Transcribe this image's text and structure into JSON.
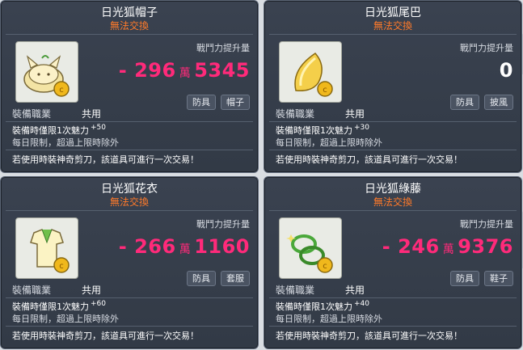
{
  "cards": [
    {
      "title": "日光狐帽子",
      "tradable": "無法交換",
      "power_label": "戰鬥力提升量",
      "power_prefix": "- 296",
      "power_unit": "萬",
      "power_rest": "5345",
      "tags": [
        "防具",
        "帽子"
      ],
      "job_label": "裝備職業",
      "job_value": "共用",
      "stat_text": "裝備時僅限1次魅力",
      "stat_bonus": "+50",
      "daily": "每日限制，超過上限時除外",
      "scissors": "若使用時裝神奇剪刀，該道具可進行一次交易！",
      "icon": "fox-hat-icon"
    },
    {
      "title": "日光狐尾巴",
      "tradable": "無法交換",
      "power_label": "戰鬥力提升量",
      "power_value": "0",
      "tags": [
        "防具",
        "披風"
      ],
      "job_label": "裝備職業",
      "job_value": "共用",
      "stat_text": "裝備時僅限1次魅力",
      "stat_bonus": "+30",
      "daily": "每日限制，超過上限時除外",
      "scissors": "若使用時裝神奇剪刀，該道具可進行一次交易！",
      "icon": "fox-tail-icon"
    },
    {
      "title": "日光狐花衣",
      "tradable": "無法交換",
      "power_label": "戰鬥力提升量",
      "power_prefix": "- 266",
      "power_unit": "萬",
      "power_rest": "1160",
      "tags": [
        "防具",
        "套服"
      ],
      "job_label": "裝備職業",
      "job_value": "共用",
      "stat_text": "裝備時僅限1次魅力",
      "stat_bonus": "+60",
      "daily": "每日限制，超過上限時除外",
      "scissors": "若使用時裝神奇剪刀，該道具可進行一次交易！",
      "icon": "fox-outfit-icon"
    },
    {
      "title": "日光狐綠藤",
      "tradable": "無法交換",
      "power_label": "戰鬥力提升量",
      "power_prefix": "- 246",
      "power_unit": "萬",
      "power_rest": "9376",
      "tags": [
        "防具",
        "鞋子"
      ],
      "job_label": "裝備職業",
      "job_value": "共用",
      "stat_text": "裝備時僅限1次魅力",
      "stat_bonus": "+40",
      "daily": "每日限制，超過上限時除外",
      "scissors": "若使用時裝神奇剪刀，該道具可進行一次交易！",
      "icon": "green-vine-icon"
    }
  ]
}
